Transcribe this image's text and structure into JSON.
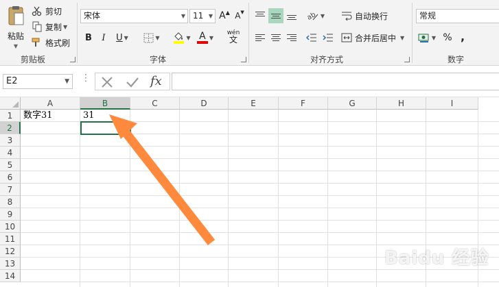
{
  "ribbon": {
    "clipboard": {
      "paste_label": "粘贴",
      "cut_label": "剪切",
      "copy_label": "复制",
      "format_painter_label": "格式刷",
      "group_label": "剪贴板"
    },
    "font": {
      "font_name": "宋体",
      "font_size": "11",
      "bold_glyph": "B",
      "italic_glyph": "I",
      "underline_glyph": "U",
      "grow_glyph": "A",
      "shrink_glyph": "A",
      "font_color_glyph": "A",
      "phonetic_glyph": "wén",
      "phonetic_glyph2": "文",
      "group_label": "字体"
    },
    "alignment": {
      "wrap_text_label": "自动换行",
      "merge_center_label": "合并后居中",
      "group_label": "对齐方式"
    },
    "number": {
      "format_value": "常规",
      "percent_glyph": "%",
      "comma_glyph": ",",
      "group_label": "数字"
    },
    "colors": {
      "accent": "#217346",
      "fill_yellow": "#ffff00",
      "font_red": "#e00000",
      "highlight_btn": "#a9d7be"
    }
  },
  "formula_bar": {
    "name_box_value": "E2",
    "fx_glyph": "fx",
    "formula_value": ""
  },
  "grid": {
    "columns": [
      "A",
      "B",
      "C",
      "D",
      "E",
      "F",
      "G",
      "H",
      "I"
    ],
    "rows": [
      "1",
      "2",
      "3",
      "4",
      "5",
      "6",
      "7",
      "8",
      "9",
      "10",
      "11",
      "12",
      "13",
      "14"
    ],
    "cells": {
      "A1": "数字31",
      "B1": "31"
    },
    "selected_column": "B",
    "selected_row": "2"
  },
  "annotation": {
    "arrow_color": "#ff8a3d"
  },
  "watermark": {
    "text": "Baidu 经验"
  }
}
